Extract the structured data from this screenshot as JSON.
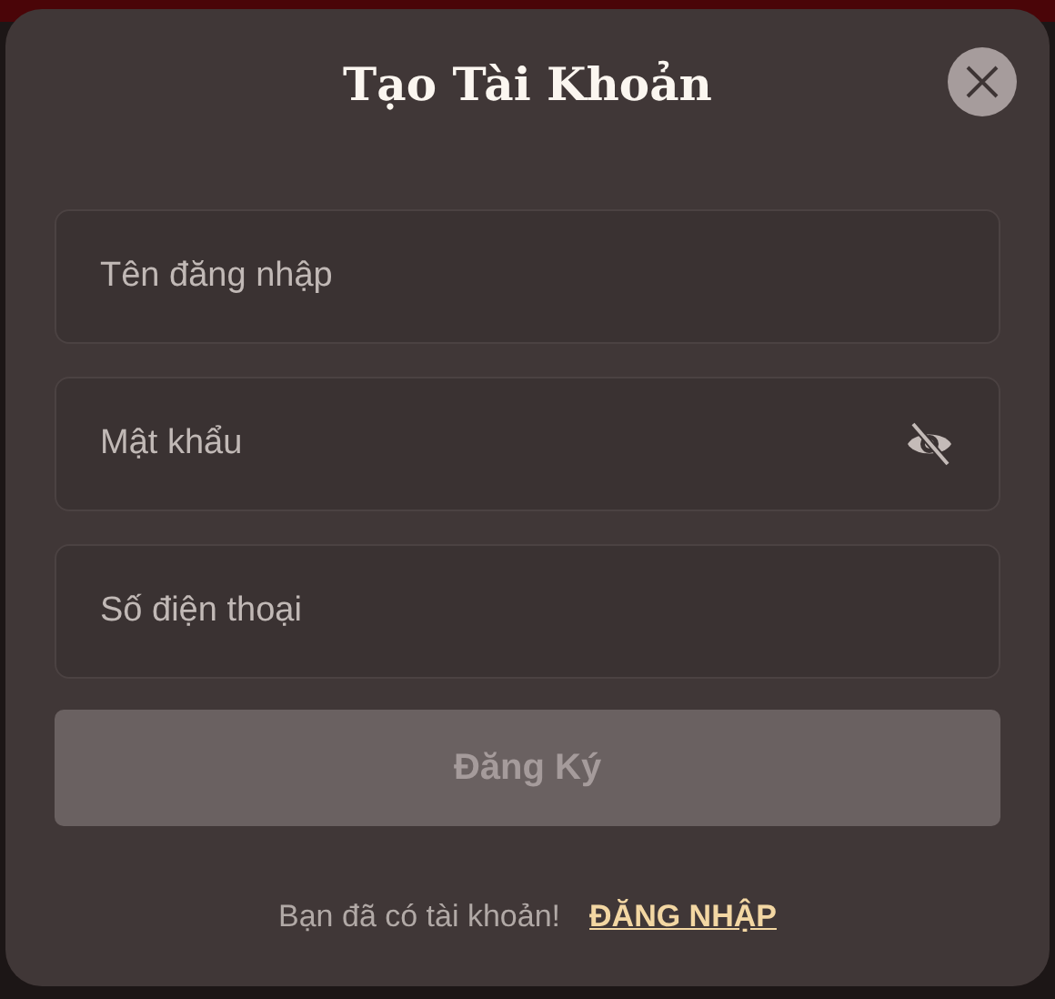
{
  "dialog": {
    "title": "Tạo Tài Khoản",
    "fields": [
      {
        "kind": "text",
        "placeholder": "Tên đăng nhập"
      },
      {
        "kind": "password",
        "placeholder": "Mật khẩu"
      },
      {
        "kind": "text",
        "placeholder": "Số điện thoại"
      }
    ],
    "submit": {
      "label": "Đăng Ký",
      "disabled": true
    },
    "footer": {
      "text": "Bạn đã có tài khoản!",
      "link": "ĐĂNG NHẬP"
    }
  }
}
